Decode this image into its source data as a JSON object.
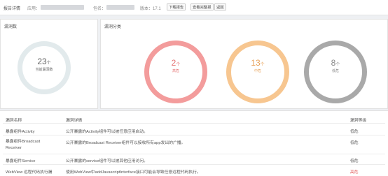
{
  "header": {
    "title": "报告详情",
    "app_label": "应用：",
    "package_label": "包名：",
    "version": "版本：17.1",
    "buttons": [
      "下载报告",
      "查看完整报",
      "返回"
    ]
  },
  "count_card": {
    "title": "漏洞数",
    "total": "23",
    "unit": "个",
    "subtitle": "当前漏洞数"
  },
  "category_card": {
    "title": "漏洞分类",
    "items": [
      {
        "count": "2",
        "unit": "个",
        "label": "高危",
        "color": "#f39c9c",
        "text_color": "#e57373"
      },
      {
        "count": "13",
        "unit": "个",
        "label": "中危",
        "color": "#f7c690",
        "text_color": "#e8a25a"
      },
      {
        "count": "8",
        "unit": "个",
        "label": "低危",
        "color": "#a9a9a9",
        "text_color": "#888888"
      }
    ]
  },
  "table": {
    "headers": [
      "漏洞名称",
      "漏洞详情",
      "漏洞等级"
    ],
    "rows": [
      {
        "name": "暴露组件Activity",
        "detail": "公开暴露的Activity组件可以被任意应用启动。",
        "level": "低危"
      },
      {
        "name": "暴露组件Broadcast Receiver",
        "detail": "公开暴露的Broadcast Receiver组件可以接收所有app发出的广播。",
        "level": "低危"
      },
      {
        "name": "暴露组件Service",
        "detail": "公开暴露的service组件可以被其他应用访问。",
        "level": "低危"
      },
      {
        "name": "WebView 远程代码执行漏",
        "detail": "使用WebView中addJavascriptInterface接口可能会导致任意远程代码执行。",
        "level": "高危"
      }
    ]
  }
}
